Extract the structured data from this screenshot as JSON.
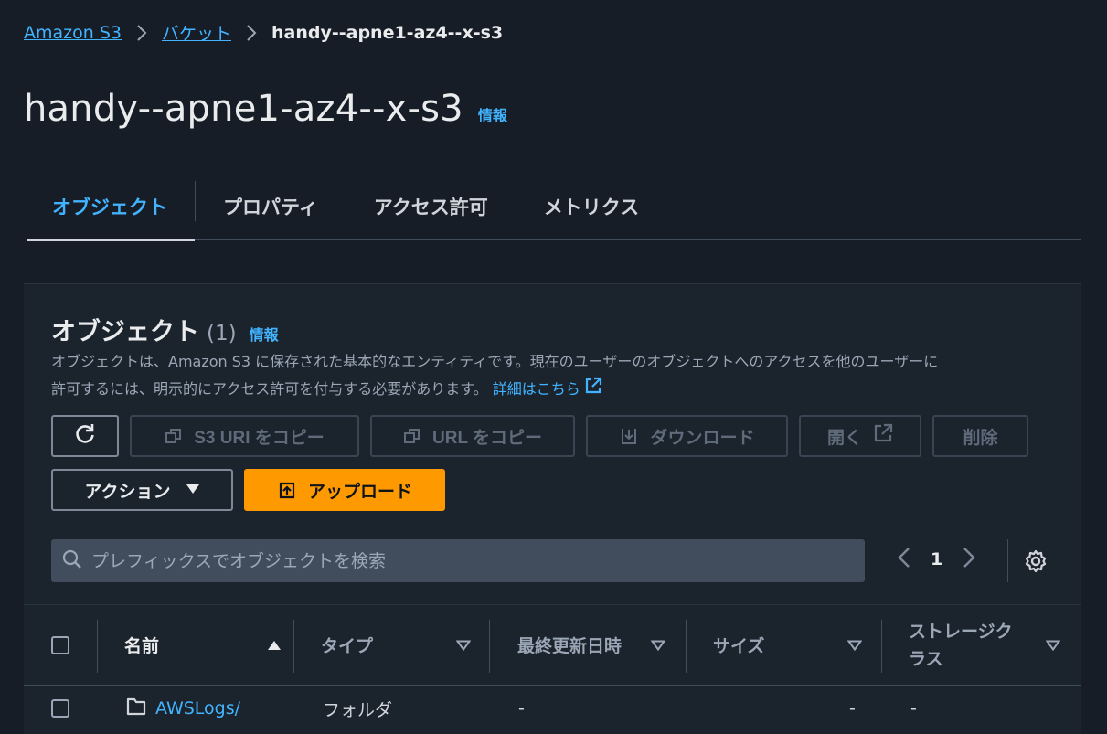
{
  "breadcrumb": {
    "items": [
      "Amazon S3",
      "バケット"
    ],
    "current": "handy--apne1-az4--x-s3"
  },
  "page": {
    "title": "handy--apne1-az4--x-s3",
    "info": "情報"
  },
  "tabs": [
    {
      "label": "オブジェクト",
      "active": true
    },
    {
      "label": "プロパティ",
      "active": false
    },
    {
      "label": "アクセス許可",
      "active": false
    },
    {
      "label": "メトリクス",
      "active": false
    }
  ],
  "objects_panel": {
    "title": "オブジェクト",
    "count": "(1)",
    "info": "情報",
    "description_line1": "オブジェクトは、Amazon S3 に保存された基本的なエンティティです。現在のユーザーのオブジェクトへのアクセスを他のユーザーに",
    "description_line2": "許可するには、明示的にアクセス許可を付与する必要があります。",
    "learn_more": "詳細はこちら"
  },
  "toolbar": {
    "copy_s3_uri": "S3 URI をコピー",
    "copy_url": "URL をコピー",
    "download": "ダウンロード",
    "open": "開く",
    "delete": "削除",
    "actions": "アクション",
    "upload": "アップロード"
  },
  "search": {
    "placeholder": "プレフィックスでオブジェクトを検索"
  },
  "pagination": {
    "current_page": "1"
  },
  "table": {
    "columns": [
      "名前",
      "タイプ",
      "最終更新日時",
      "サイズ",
      "ストレージクラス"
    ],
    "storage_class_line1": "ストレージク",
    "storage_class_line2": "ラス",
    "rows": [
      {
        "name": "AWSLogs/",
        "type": "フォルダ",
        "last_modified": "-",
        "size": "-",
        "storage_class": "-"
      }
    ]
  },
  "colors": {
    "background": "#161d26",
    "panel": "#1b232d",
    "link": "#42b4ff",
    "primary": "#ff9900"
  }
}
